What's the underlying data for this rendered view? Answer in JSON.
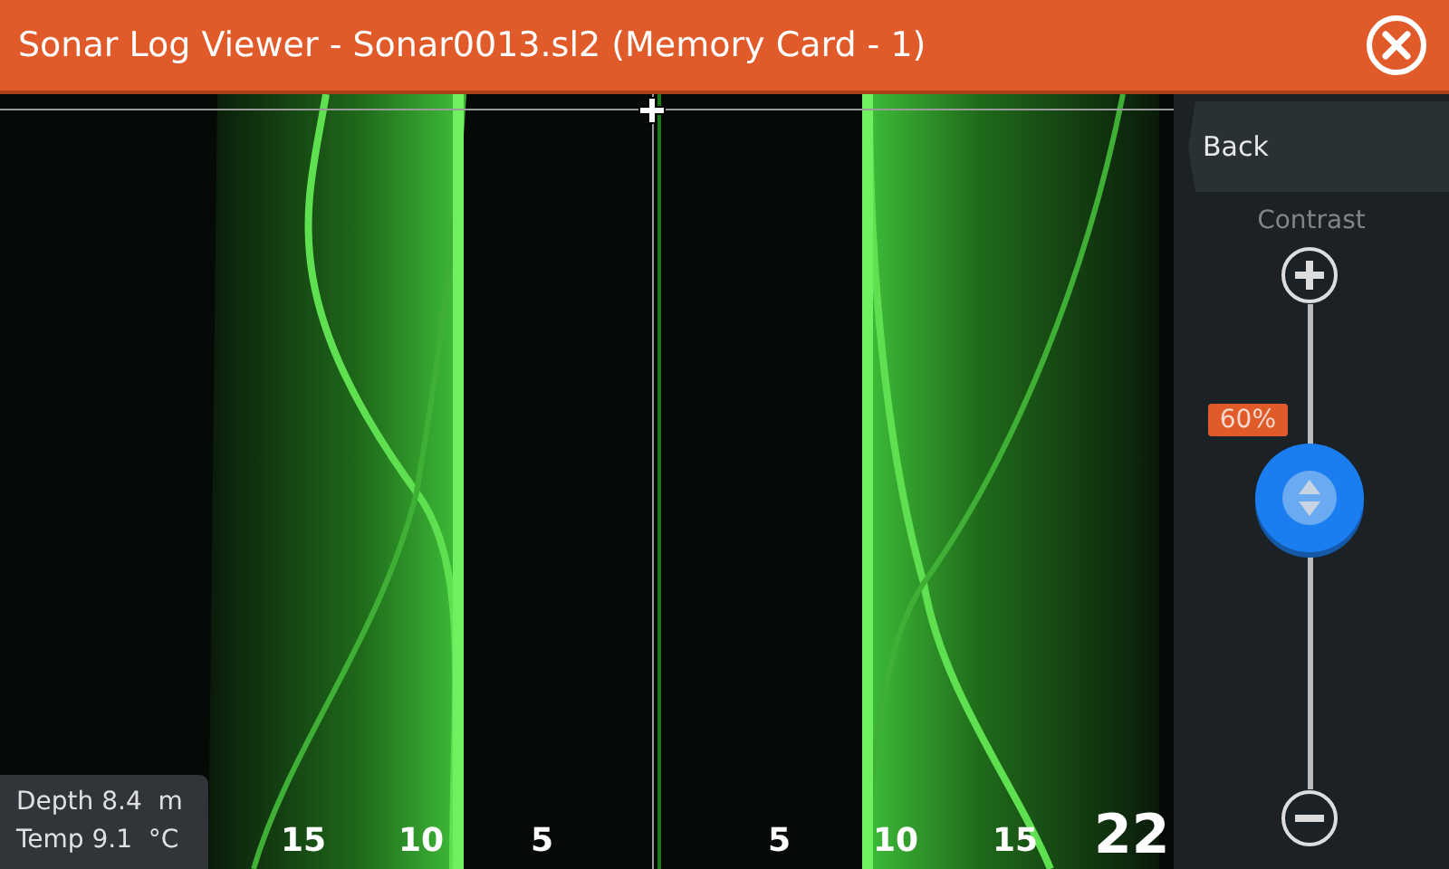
{
  "window": {
    "title": "Sonar Log Viewer - Sonar0013.sl2 (Memory Card - 1)"
  },
  "sonar": {
    "readout": [
      {
        "label": "Depth",
        "value": "8.4",
        "unit": "m"
      },
      {
        "label": "Temp",
        "value": "9.1",
        "unit": "°C"
      }
    ],
    "range_labels": [
      "15",
      "10",
      "5",
      "5",
      "10",
      "15"
    ],
    "scale_numbers": [
      "22"
    ]
  },
  "panel": {
    "back": "Back",
    "contrast": {
      "label": "Contrast",
      "level": 0.6,
      "reading": "60%"
    }
  }
}
